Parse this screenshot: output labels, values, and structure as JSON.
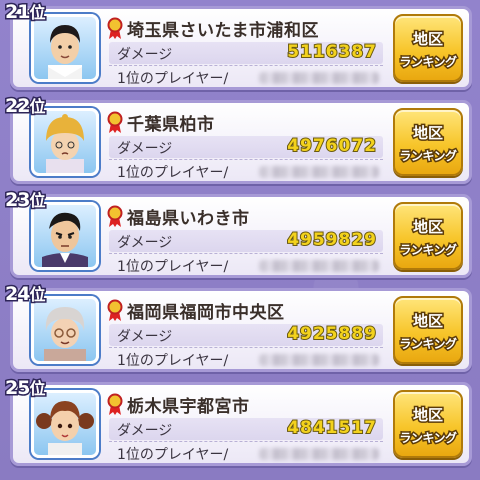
{
  "entries": [
    {
      "rank": "21",
      "rank_suffix": "位",
      "area": "埼玉県さいたま市浦和区",
      "damage_label": "ダメージ",
      "damage": "5116387",
      "player_label": "1位のプレイヤー/",
      "avatar": "man-dark-hair-icon"
    },
    {
      "rank": "22",
      "rank_suffix": "位",
      "area": "千葉県柏市",
      "damage_label": "ダメージ",
      "damage": "4976072",
      "player_label": "1位のプレイヤー/",
      "avatar": "girl-yellow-hat-icon"
    },
    {
      "rank": "23",
      "rank_suffix": "位",
      "area": "福島県いわき市",
      "damage_label": "ダメージ",
      "damage": "4959829",
      "player_label": "1位のプレイヤー/",
      "avatar": "man-suit-icon"
    },
    {
      "rank": "24",
      "rank_suffix": "位",
      "area": "福岡県福岡市中央区",
      "damage_label": "ダメージ",
      "damage": "4925889",
      "player_label": "1位のプレイヤー/",
      "avatar": "old-woman-glasses-icon"
    },
    {
      "rank": "25",
      "rank_suffix": "位",
      "area": "栃木県宇都宮市",
      "damage_label": "ダメージ",
      "damage": "4841517",
      "player_label": "1位のプレイヤー/",
      "avatar": "girl-pigtails-icon"
    }
  ],
  "button": {
    "line1": "地区",
    "line2": "ランキング"
  },
  "colors": {
    "background": "#8f80c8",
    "damage": "#f3d21d",
    "button": "#f7c52a"
  }
}
